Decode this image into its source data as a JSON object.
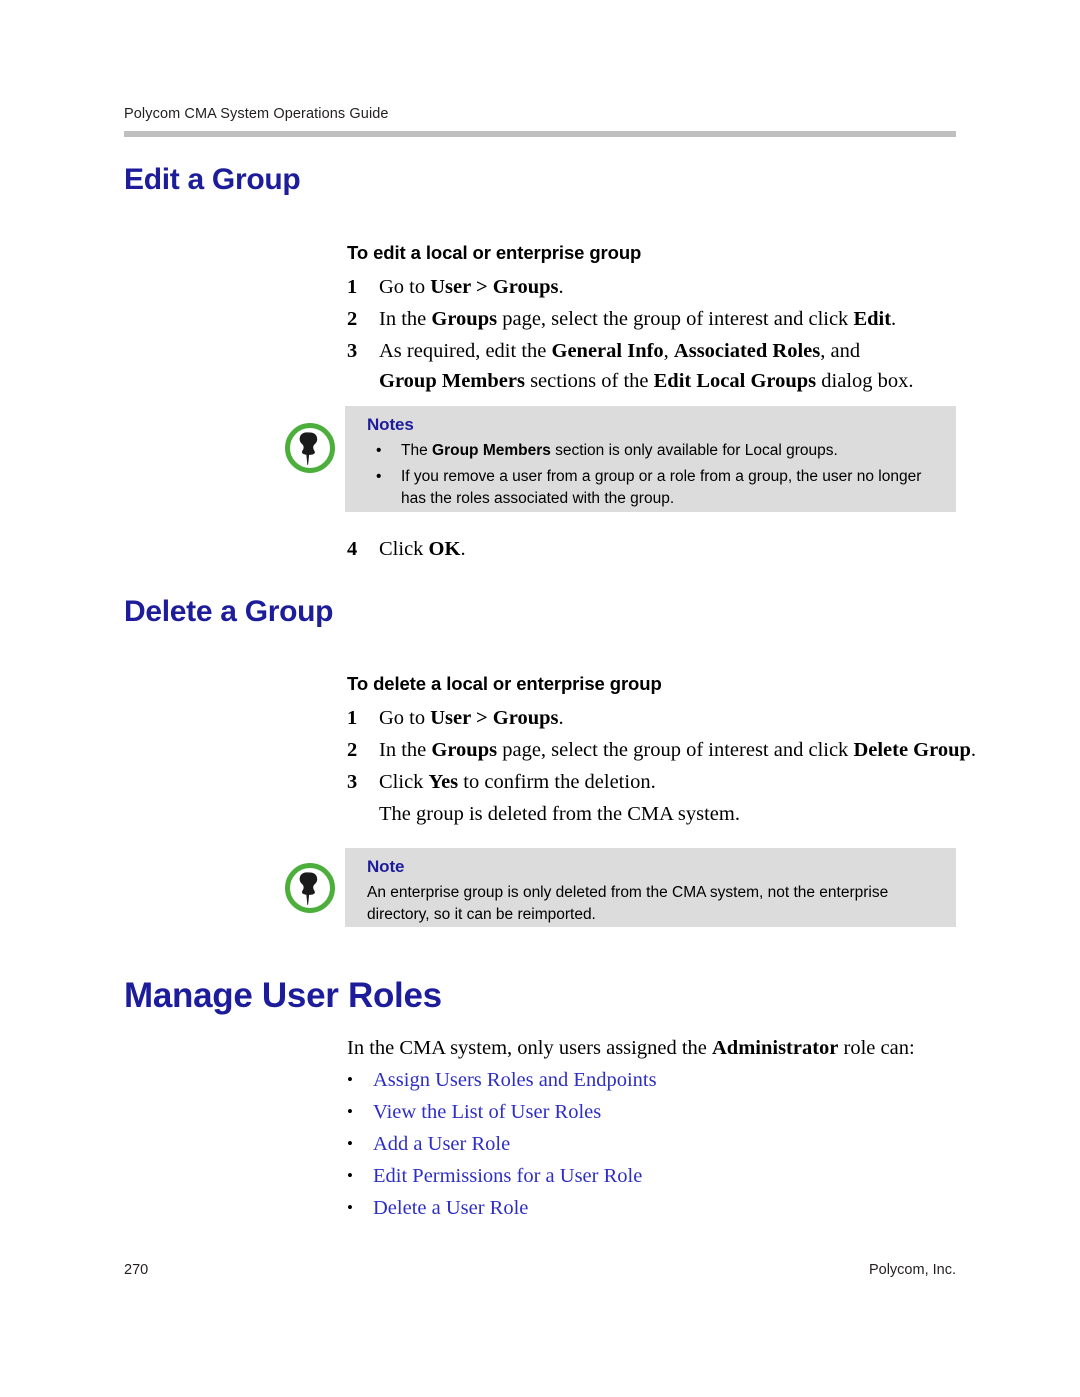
{
  "page": {
    "running_header": "Polycom CMA System Operations Guide",
    "footer_page_number": "270",
    "footer_company": "Polycom, Inc.",
    "accent_blue": "#1d1d9c",
    "link_blue": "#2e2ec4",
    "note_green": "#4caf3c",
    "note_bg": "#dcdcdc",
    "rule_gray": "#bfbfbf"
  },
  "edit_group": {
    "heading": "Edit a Group",
    "procedure_title": "To edit a local or enterprise group",
    "steps": [
      {
        "num": "1",
        "html": "Go to <b>User &gt; Groups</b>."
      },
      {
        "num": "2",
        "html": "In the <b>Groups</b> page, select the group of interest and click <b>Edit</b>."
      },
      {
        "num": "3",
        "html": "As required, edit the <b>General Info</b>, <b>Associated Roles</b>, and <b>Group Members</b> sections of the <b>Edit Local Groups</b> dialog box."
      },
      {
        "num": "4",
        "html": "Click <b>OK</b>."
      }
    ],
    "note": {
      "icon": "pushpin-icon",
      "title": "Notes",
      "bullets": [
        "The <b>Group Members</b> section is only available for Local groups.",
        "If you remove a user from a group or a role from a group, the user no longer has the roles associated with the group."
      ]
    }
  },
  "delete_group": {
    "heading": "Delete a Group",
    "procedure_title": "To delete a local or enterprise group",
    "steps": [
      {
        "num": "1",
        "html": "Go to <b>User &gt; Groups</b>."
      },
      {
        "num": "2",
        "html": "In the <b>Groups</b> page, select the group of interest and click <b>Delete Group</b>."
      },
      {
        "num": "3",
        "html": "Click <b>Yes</b> to confirm the deletion."
      }
    ],
    "result_text": "The group is deleted from the CMA system.",
    "note": {
      "icon": "pushpin-icon",
      "title": "Note",
      "body": "An enterprise group is only deleted from the CMA system, not the enterprise directory, so it can be reimported."
    }
  },
  "manage_user_roles": {
    "heading": "Manage User Roles",
    "intro_html": "In the CMA system, only users assigned the <b>Administrator</b> role can:",
    "links": [
      "Assign Users Roles and Endpoints",
      "View the List of User Roles",
      "Add a User Role",
      "Edit Permissions for a User Role",
      "Delete a User Role"
    ]
  }
}
